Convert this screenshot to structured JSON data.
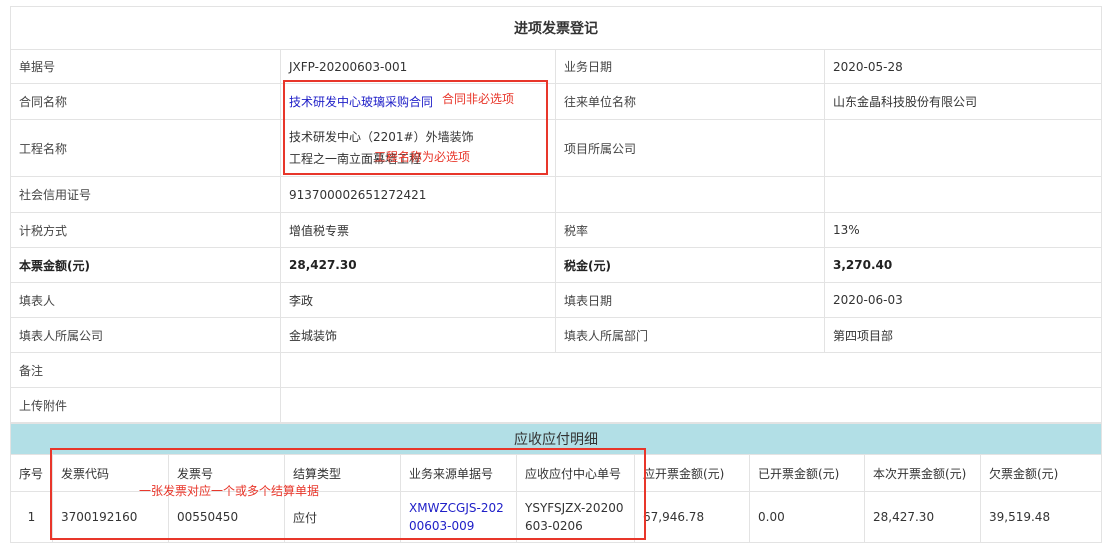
{
  "title": "进项发票登记",
  "fields": {
    "bill_no_label": "单据号",
    "bill_no": "JXFP-20200603-001",
    "biz_date_label": "业务日期",
    "biz_date": "2020-05-28",
    "contract_label": "合同名称",
    "contract": "技术研发中心玻璃采购合同",
    "partner_label": "往来单位名称",
    "partner": "山东金晶科技股份有限公司",
    "project_label": "工程名称",
    "project": "技术研发中心（2201#）外墙装饰工程之一南立面幕墙工程",
    "project_company_label": "项目所属公司",
    "project_company": "",
    "credit_label": "社会信用证号",
    "credit": "913700002651272421",
    "tax_method_label": "计税方式",
    "tax_method": "增值税专票",
    "tax_rate_label": "税率",
    "tax_rate": "13%",
    "amount_label": "本票金额(元)",
    "amount": "28,427.30",
    "tax_label": "税金(元)",
    "tax": "3,270.40",
    "filler_label": "填表人",
    "filler": "李政",
    "fill_date_label": "填表日期",
    "fill_date": "2020-06-03",
    "filler_company_label": "填表人所属公司",
    "filler_company": "金城装饰",
    "filler_dept_label": "填表人所属部门",
    "filler_dept": "第四项目部",
    "remark_label": "备注",
    "remark": "",
    "attachment_label": "上传附件"
  },
  "detail": {
    "title": "应收应付明细",
    "headers": [
      "序号",
      "发票代码",
      "发票号",
      "结算类型",
      "业务来源单据号",
      "应收应付中心单号",
      "应开票金额(元)",
      "已开票金额(元)",
      "本次开票金额(元)",
      "欠票金额(元)"
    ],
    "rows": [
      [
        "1",
        "3700192160",
        "00550450",
        "应付",
        "XMWZCGJS-20200603-009",
        "YSYFSJZX-20200603-0206",
        "67,946.78",
        "0.00",
        "28,427.30",
        "39,519.48"
      ]
    ]
  },
  "annotations": {
    "contract_note": "合同非必选项",
    "project_note": "工程名称为必选项",
    "detail_note": "一张发票对应一个或多个结算单据"
  }
}
